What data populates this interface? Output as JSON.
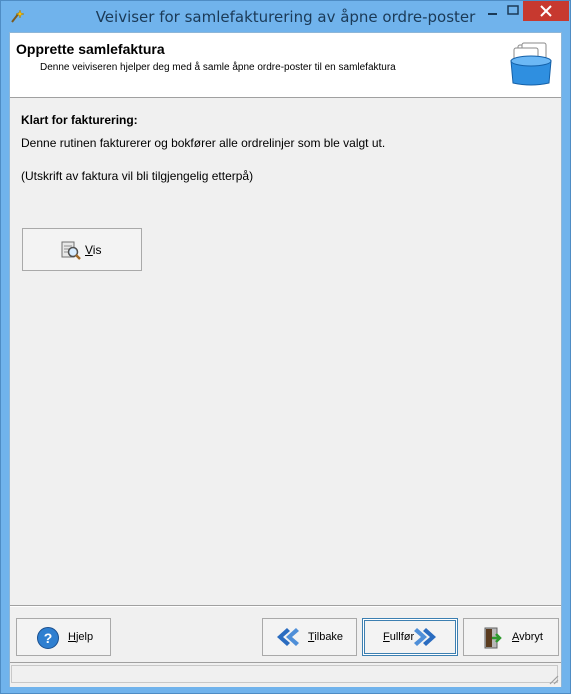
{
  "window": {
    "title": "Veiviser for samlefakturering av åpne ordre-poster"
  },
  "header": {
    "title": "Opprette samlefaktura",
    "subtitle": "Denne veiviseren hjelper deg med å samle åpne ordre-poster til en samlefaktura",
    "icon": "card-box-icon"
  },
  "body": {
    "heading": "Klart for fakturering:",
    "line1": "Denne rutinen fakturerer og bokfører alle ordrelinjer som ble valgt ut.",
    "line2": "(Utskrift av faktura vil bli tilgjengelig etterpå)",
    "vis_button": {
      "mnemonic": "V",
      "rest": "is",
      "icon": "preview-icon"
    }
  },
  "footer": {
    "help": {
      "mnemonic": "H",
      "rest": "jelp",
      "icon": "help-icon"
    },
    "back": {
      "mnemonic": "T",
      "rest": "ilbake",
      "icon": "back-arrows-icon"
    },
    "finish": {
      "mnemonic": "F",
      "rest": "ullfør",
      "icon": "forward-arrows-icon"
    },
    "cancel": {
      "mnemonic": "A",
      "rest": "vbryt",
      "icon": "exit-door-icon"
    }
  },
  "colors": {
    "titlebar": "#70b3ec",
    "close": "#c7392f",
    "arrows": "#2a6cc0"
  }
}
